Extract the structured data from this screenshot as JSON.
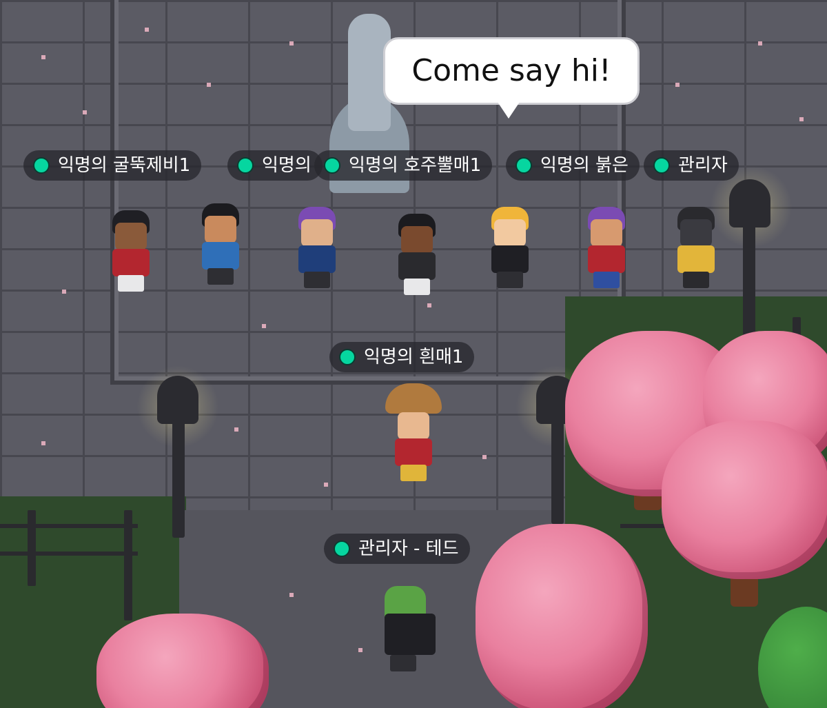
{
  "speech_bubble": {
    "text": "Come say hi!"
  },
  "players": [
    {
      "name": "익명의 굴뚝제비1",
      "status_color": "#06d6a0"
    },
    {
      "name": "익명의",
      "status_color": "#06d6a0"
    },
    {
      "name": "익명의 호주뿔매1",
      "status_color": "#06d6a0"
    },
    {
      "name": "익명의 붉은",
      "status_color": "#06d6a0"
    },
    {
      "name": "관리자",
      "status_color": "#06d6a0"
    },
    {
      "name": "익명의 흰매1",
      "status_color": "#06d6a0"
    },
    {
      "name": "관리자 - 테드",
      "status_color": "#06d6a0"
    }
  ],
  "colors": {
    "stone": "#5b5b64",
    "grass": "#2f4a2c",
    "blossom": "#e9809f",
    "online_dot": "#06d6a0",
    "tag_background": "rgba(40,40,46,0.78)"
  }
}
